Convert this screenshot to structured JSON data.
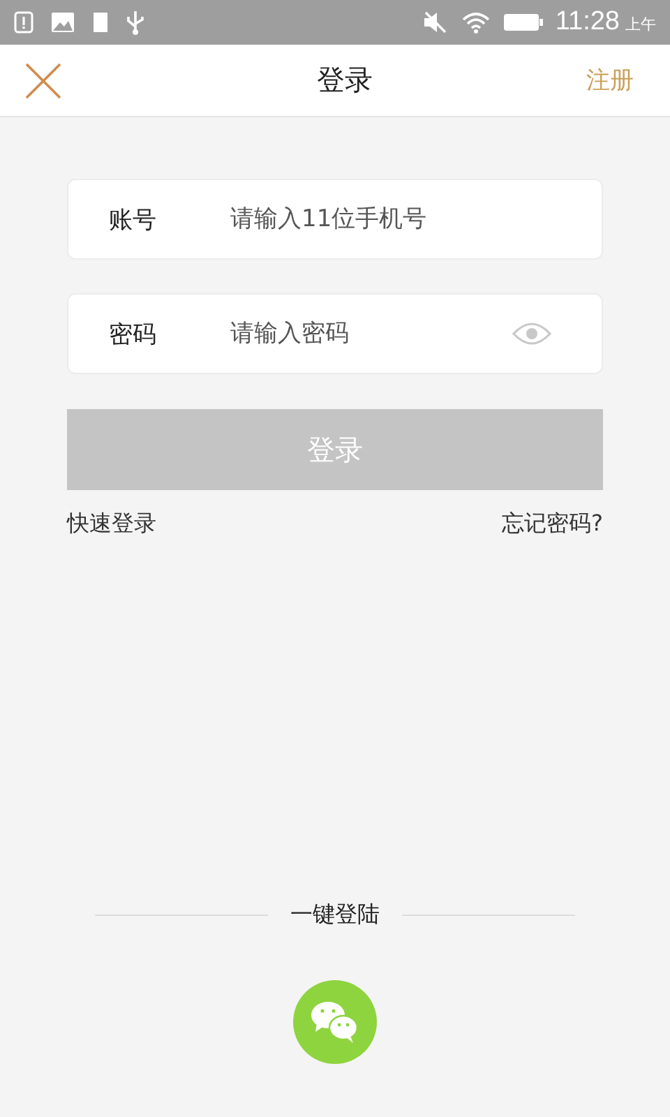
{
  "status_bar": {
    "time": "11:28",
    "period": "上午"
  },
  "nav": {
    "title": "登录",
    "action": "注册"
  },
  "fields": [
    {
      "kind": "text",
      "label": "账号",
      "placeholder": "请输入11位手机号"
    },
    {
      "kind": "password",
      "label": "密码",
      "placeholder": "请输入密码"
    }
  ],
  "login_button": {
    "label": "登录",
    "disabled": true
  },
  "links": [
    "快速登录",
    "忘记密码?"
  ],
  "quick_login": {
    "label": "一键登陆"
  }
}
